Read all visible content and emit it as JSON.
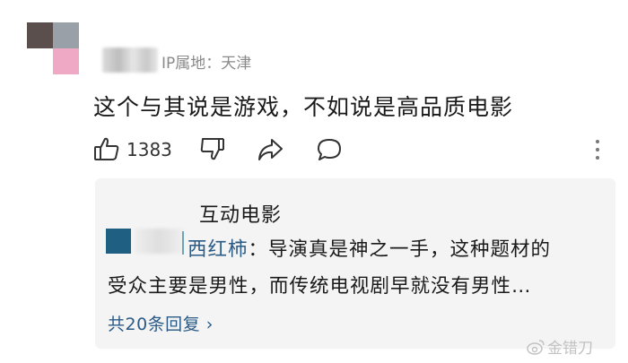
{
  "comment": {
    "meta": "IP属地：天津",
    "text": "这个与其说是游戏，不如说是高品质电影",
    "like_count": "1383"
  },
  "replies_panel": {
    "title": "互动电影",
    "reply_user": "西红柿",
    "reply_line1": "：导演真是神之一手，这种题材的",
    "reply_line2": "受众主要是男性，而传统电视剧早就没有男性…",
    "more_replies": "共20条回复 ›"
  },
  "watermark": "金错刀",
  "colors": {
    "link": "#2a5a86",
    "panel_bg": "#f4f4f4",
    "meta_gray": "#8a8a8a"
  },
  "icons": [
    "thumbs-up-icon",
    "thumbs-down-icon",
    "share-icon",
    "reply-bubble-icon",
    "more-vertical-icon",
    "weibo-icon"
  ]
}
